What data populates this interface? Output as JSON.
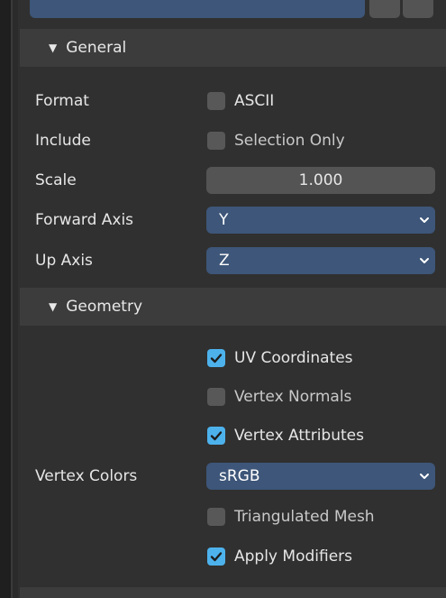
{
  "sections": {
    "general": {
      "title": "General",
      "format": {
        "label": "Format",
        "option": "ASCII",
        "checked": false
      },
      "include": {
        "label": "Include",
        "option": "Selection Only",
        "checked": false
      },
      "scale": {
        "label": "Scale",
        "value": "1.000"
      },
      "forward_axis": {
        "label": "Forward Axis",
        "value": "Y"
      },
      "up_axis": {
        "label": "Up Axis",
        "value": "Z"
      }
    },
    "geometry": {
      "title": "Geometry",
      "uv_coordinates": {
        "label": "UV Coordinates",
        "checked": true
      },
      "vertex_normals": {
        "label": "Vertex Normals",
        "checked": false
      },
      "vertex_attributes": {
        "label": "Vertex Attributes",
        "checked": true
      },
      "vertex_colors": {
        "label": "Vertex Colors",
        "value": "sRGB"
      },
      "triangulated_mesh": {
        "label": "Triangulated Mesh",
        "checked": false
      },
      "apply_modifiers": {
        "label": "Apply Modifiers",
        "checked": true
      }
    }
  },
  "icons": {
    "expand": "triangle-down-icon",
    "dropdown": "chevron-down-icon",
    "check": "checkmark-icon"
  },
  "colors": {
    "panel": "#303030",
    "header": "#3c3c3c",
    "field": "#545454",
    "dropdown": "#3d5679",
    "checkbox_on": "#4db2ec",
    "checkbox_off": "#585858"
  }
}
